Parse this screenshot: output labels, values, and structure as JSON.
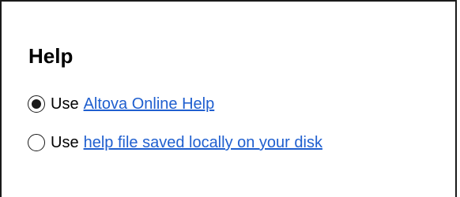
{
  "section": {
    "title": "Help"
  },
  "options": [
    {
      "prefix": "Use",
      "link_text": "Altova Online Help",
      "selected": true
    },
    {
      "prefix": "Use",
      "link_text": "help file saved locally on your disk",
      "selected": false
    }
  ],
  "colors": {
    "link": "#1f5fcf",
    "text": "#000000",
    "border": "#1a1a1a"
  }
}
